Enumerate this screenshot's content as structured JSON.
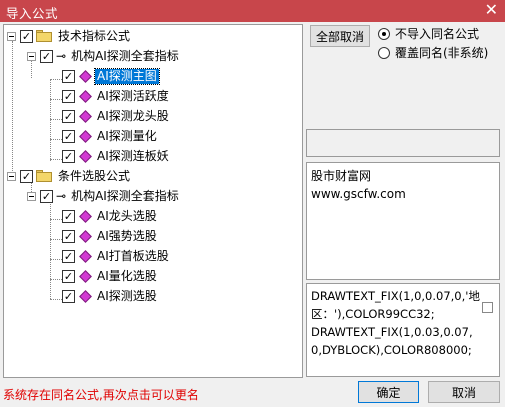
{
  "window": {
    "title": "导入公式",
    "close_glyph": "✕"
  },
  "tree": {
    "groups": [
      {
        "label": "技术指标公式",
        "checked": true,
        "formula_set": {
          "label": "机构AI探测全套指标",
          "checked": true,
          "items": [
            {
              "label": "AI探测主图",
              "checked": true,
              "selected": true
            },
            {
              "label": "AI探测活跃度",
              "checked": true
            },
            {
              "label": "AI探测龙头股",
              "checked": true
            },
            {
              "label": "AI探测量化",
              "checked": true
            },
            {
              "label": "AI探测连板妖",
              "checked": true
            }
          ]
        }
      },
      {
        "label": "条件选股公式",
        "checked": true,
        "formula_set": {
          "label": "机构AI探测全套指标",
          "checked": true,
          "items": [
            {
              "label": "AI龙头选股",
              "checked": true
            },
            {
              "label": "AI强势选股",
              "checked": true
            },
            {
              "label": "AI打首板选股",
              "checked": true
            },
            {
              "label": "AI量化选股",
              "checked": true
            },
            {
              "label": "AI探测选股",
              "checked": true
            }
          ]
        }
      }
    ],
    "check_glyph": "✓",
    "key_glyph": "⊸"
  },
  "actions": {
    "deselect_all": "全部取消",
    "options": [
      {
        "label": "不导入同名公式",
        "selected": true
      },
      {
        "label": "覆盖同名(非系统)",
        "selected": false
      }
    ]
  },
  "info": {
    "line1": "股市财富网",
    "line2": "www.gscfw.com"
  },
  "code": {
    "text": "DRAWTEXT_FIX(1,0,0.07,0,'地区：'),COLOR99CC32;\nDRAWTEXT_FIX(1,0.03,0.07,0,DYBLOCK),COLOR808000;"
  },
  "status": {
    "message": "系统存在同名公式,再次点击可以更名"
  },
  "buttons": {
    "ok": "确定",
    "cancel": "取消"
  },
  "colors": {
    "titlebar": "#c8464b",
    "selection": "#0078d7",
    "status_text": "#e00000",
    "diamond": "#d23ad2",
    "folder": "#f3d66a"
  }
}
